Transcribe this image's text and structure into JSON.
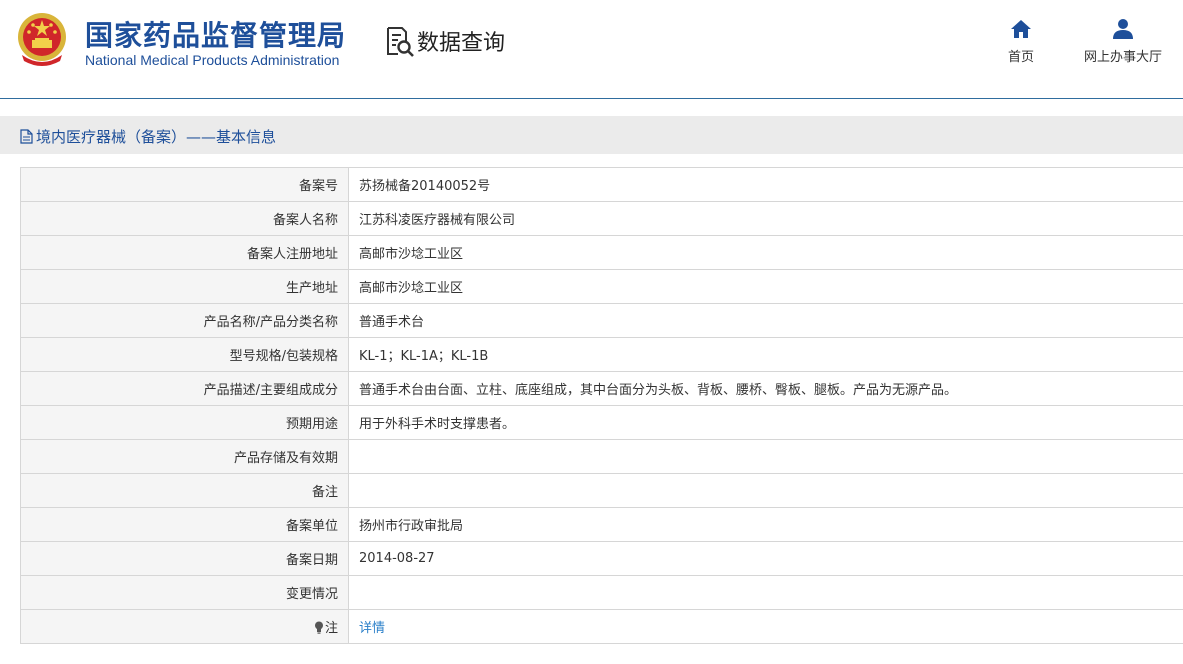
{
  "header": {
    "title_cn": "国家药品监督管理局",
    "title_en": "National Medical Products Administration",
    "query_label": "数据查询",
    "nav": [
      {
        "label": "首页",
        "icon": "home-icon"
      },
      {
        "label": "网上办事大厅",
        "icon": "user-icon"
      }
    ]
  },
  "section": {
    "title": "境内医疗器械（备案）——基本信息"
  },
  "rows": [
    {
      "label": "备案号",
      "value": "苏扬械备20140052号"
    },
    {
      "label": "备案人名称",
      "value": "江苏科凌医疗器械有限公司"
    },
    {
      "label": "备案人注册地址",
      "value": "高邮市沙埝工业区"
    },
    {
      "label": "生产地址",
      "value": "高邮市沙埝工业区"
    },
    {
      "label": "产品名称/产品分类名称",
      "value": "普通手术台"
    },
    {
      "label": "型号规格/包装规格",
      "value": "KL-1；KL-1A；KL-1B"
    },
    {
      "label": "产品描述/主要组成成分",
      "value": "普通手术台由台面、立柱、底座组成，其中台面分为头板、背板、腰桥、臀板、腿板。产品为无源产品。"
    },
    {
      "label": "预期用途",
      "value": "用于外科手术时支撑患者。"
    },
    {
      "label": "产品存储及有效期",
      "value": ""
    },
    {
      "label": "备注",
      "value": ""
    },
    {
      "label": "备案单位",
      "value": "扬州市行政审批局"
    },
    {
      "label": "备案日期",
      "value": "2014-08-27"
    },
    {
      "label": "变更情况",
      "value": ""
    }
  ],
  "note_row": {
    "label": "注",
    "link": "详情",
    "icon": "lightbulb-icon"
  },
  "colors": {
    "brand": "#1e4f9a",
    "link": "#2a7fc9",
    "label_bg": "#f5f5f5",
    "section_bg": "#ebebeb"
  }
}
